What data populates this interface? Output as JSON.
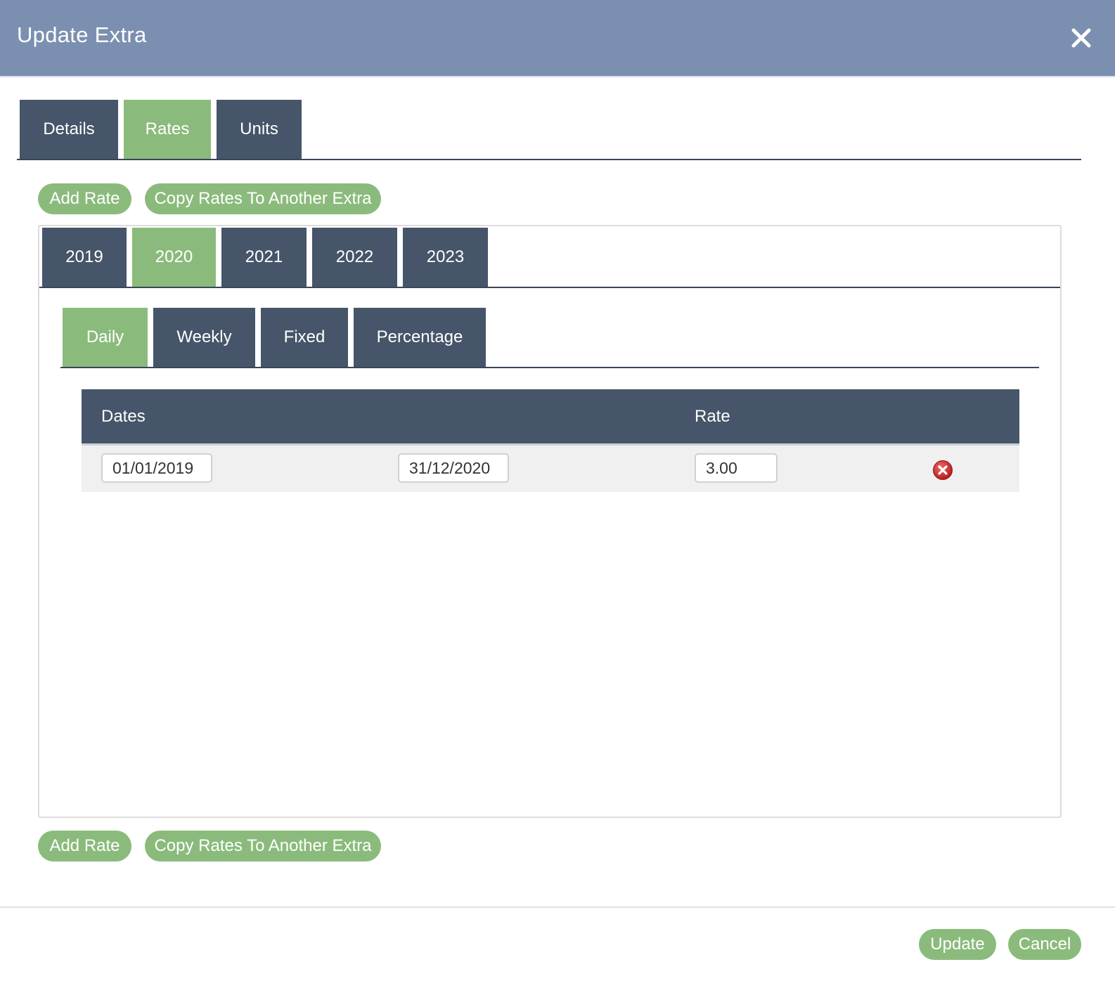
{
  "header": {
    "title": "Update Extra",
    "close_icon": "close-icon"
  },
  "main_tabs": [
    {
      "label": "Details",
      "active": false
    },
    {
      "label": "Rates",
      "active": true
    },
    {
      "label": "Units",
      "active": false
    }
  ],
  "actions": {
    "add_rate": "Add Rate",
    "copy_rates": "Copy Rates To Another Extra"
  },
  "year_tabs": [
    {
      "label": "2019",
      "active": false
    },
    {
      "label": "2020",
      "active": true
    },
    {
      "label": "2021",
      "active": false
    },
    {
      "label": "2022",
      "active": false
    },
    {
      "label": "2023",
      "active": false
    }
  ],
  "rate_type_tabs": [
    {
      "label": "Daily",
      "active": true
    },
    {
      "label": "Weekly",
      "active": false
    },
    {
      "label": "Fixed",
      "active": false
    },
    {
      "label": "Percentage",
      "active": false
    }
  ],
  "table": {
    "headers": {
      "dates": "Dates",
      "rate": "Rate"
    },
    "rows": [
      {
        "from": "01/01/2019",
        "to": "31/12/2020",
        "rate": "3.00",
        "delete_icon": "delete-icon"
      }
    ]
  },
  "footer": {
    "update": "Update",
    "cancel": "Cancel"
  },
  "colors": {
    "header": "#7b90b0",
    "tab_dark": "#465569",
    "accent_green": "#8bbb7c",
    "delete_red": "#d42a2a"
  }
}
